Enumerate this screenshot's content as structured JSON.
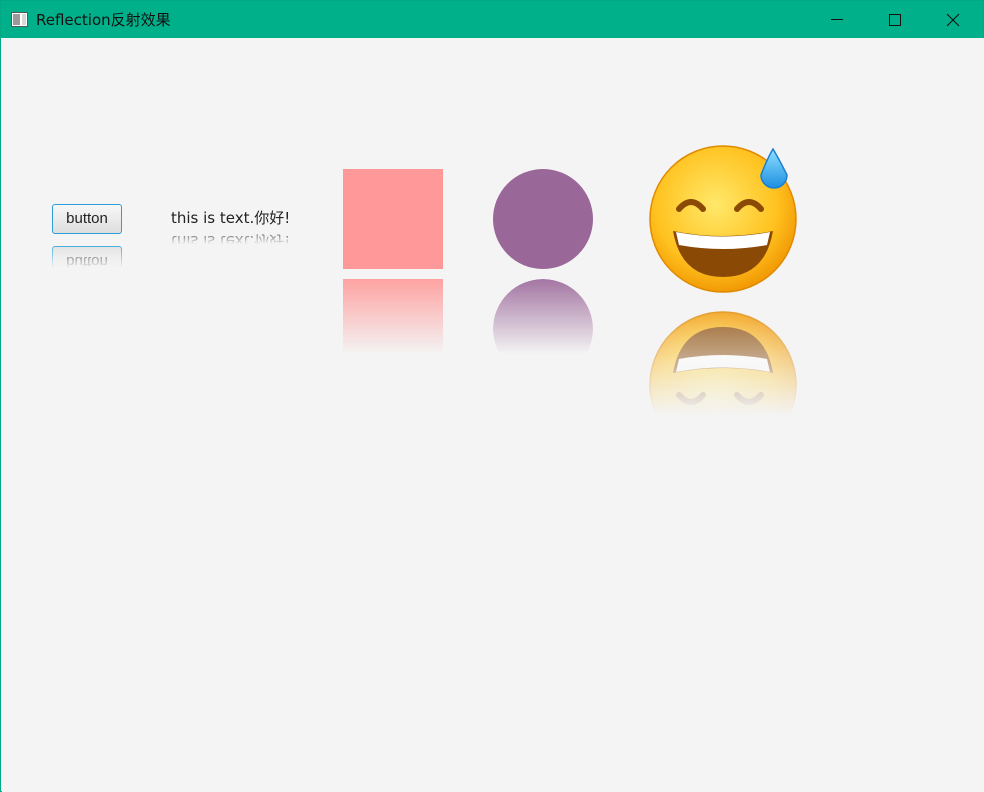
{
  "window": {
    "title": "Reflection反射效果",
    "accent_color": "#00b08a",
    "controls": {
      "minimize_icon": "minimize-icon",
      "maximize_icon": "maximize-icon",
      "close_icon": "close-icon"
    }
  },
  "content": {
    "button_label": "button",
    "text_label": "this is text.你好!",
    "rectangle_color": "#ff9999",
    "circle_color": "#9a6799",
    "emoji_icon": "grinning-face-with-sweat-icon"
  }
}
